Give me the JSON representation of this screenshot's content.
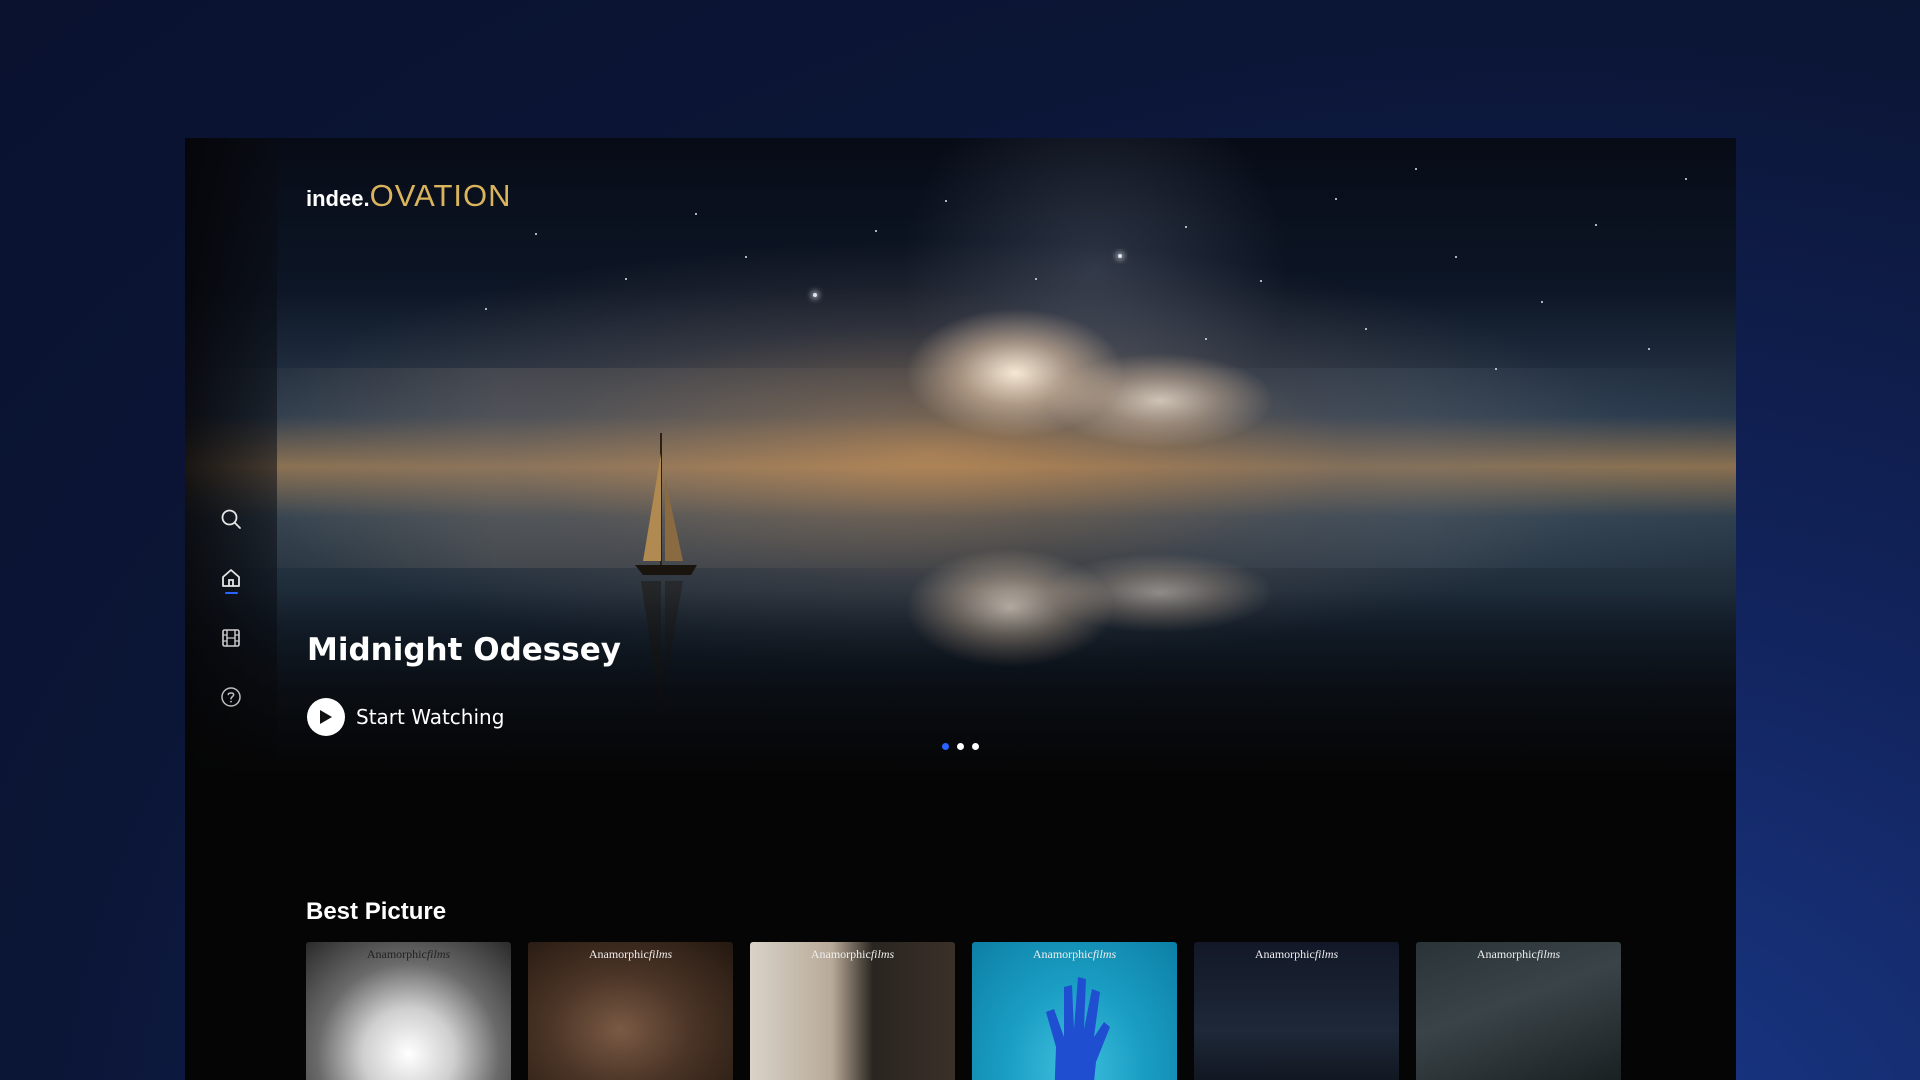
{
  "app": {
    "logo": {
      "part1": "indee.",
      "part2": "OVATION"
    }
  },
  "sidebar": {
    "items": [
      {
        "icon": "search-icon",
        "active": false
      },
      {
        "icon": "home-icon",
        "active": true
      },
      {
        "icon": "film-icon",
        "active": false
      },
      {
        "icon": "help-icon",
        "active": false
      }
    ]
  },
  "hero": {
    "title": "Midnight Odessey",
    "cta_label": "Start Watching",
    "carousel": {
      "count": 3,
      "active_index": 0
    }
  },
  "sections": [
    {
      "title": "Best Picture",
      "cards": [
        {
          "brand": "Anamorphic",
          "brand_italic": "films"
        },
        {
          "brand": "Anamorphic",
          "brand_italic": "films"
        },
        {
          "brand": "Anamorphic",
          "brand_italic": "films"
        },
        {
          "brand": "Anamorphic",
          "brand_italic": "films"
        },
        {
          "brand": "Anamorphic",
          "brand_italic": "films"
        },
        {
          "brand": "Anamorphic",
          "brand_italic": "films"
        }
      ]
    }
  ],
  "colors": {
    "accent": "#2a63ff",
    "logo_gold": "#d9b45c",
    "background": "#050505"
  }
}
